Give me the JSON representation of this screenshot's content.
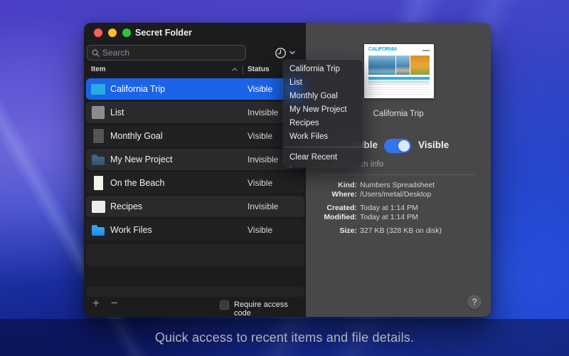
{
  "window": {
    "title": "Secret Folder"
  },
  "search": {
    "placeholder": "Search"
  },
  "table": {
    "columns": {
      "item": "Item",
      "status": "Status"
    },
    "rows": [
      {
        "name": "California Trip",
        "status": "Visible",
        "selected": true,
        "icon": "doc-photos"
      },
      {
        "name": "List",
        "status": "Invisible",
        "selected": false,
        "icon": "gray-square"
      },
      {
        "name": "Monthly Goal",
        "status": "Visible",
        "selected": false,
        "icon": "chart-doc"
      },
      {
        "name": "My New Project",
        "status": "Invisible",
        "selected": false,
        "icon": "folder-dark"
      },
      {
        "name": "On the Beach",
        "status": "Visible",
        "selected": false,
        "icon": "photo-beach"
      },
      {
        "name": "Recipes",
        "status": "Invisible",
        "selected": false,
        "icon": "book-olive"
      },
      {
        "name": "Work Files",
        "status": "Visible",
        "selected": false,
        "icon": "folder-blue"
      }
    ]
  },
  "recents_menu": {
    "items": [
      "California Trip",
      "List",
      "Monthly Goal",
      "My New Project",
      "Recipes",
      "Work Files"
    ],
    "highlighted": "List",
    "clear_label": "Clear Recent Items"
  },
  "detail": {
    "preview_title": "CALIFORNIA",
    "preview_caption": "California Trip",
    "toggle": {
      "off_label": "Invisible",
      "on_label": "Visible",
      "state": "on"
    },
    "disclosure_label": "Hide item info",
    "info": [
      {
        "label": "Kind:",
        "value": "Numbers Spreadsheet",
        "gap": false
      },
      {
        "label": "Where:",
        "value": "/Users/metal/Desktop",
        "gap": false
      },
      {
        "label": "Created:",
        "value": "Today at 1:14 PM",
        "gap": true
      },
      {
        "label": "Modified:",
        "value": "Today at 1:14 PM",
        "gap": false
      },
      {
        "label": "Size:",
        "value": "327 KB (328 KB on disk)",
        "gap": true
      }
    ],
    "help_label": "?"
  },
  "footer": {
    "add_label": "+",
    "remove_label": "−",
    "checkbox_label": "Require access code",
    "checked": false
  },
  "caption": "Quick access to recent items and file details.",
  "colors": {
    "accent": "#1b63e8",
    "toggle_on": "#3574f0",
    "left_bg": "#1c1c1e",
    "right_bg": "#48484a",
    "menu_bg": "#2a2a2f"
  }
}
